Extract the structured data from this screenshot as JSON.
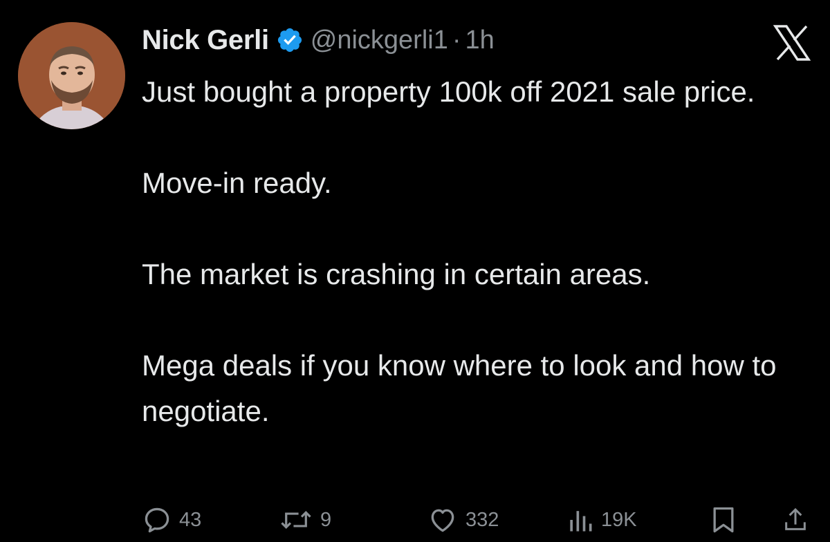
{
  "tweet": {
    "author": {
      "name": "Nick Gerli",
      "handle": "@nickgerli1",
      "separator": "·",
      "time": "1h",
      "verified": true,
      "avatar_icon": "profile-photo"
    },
    "platform_icon": "x-logo-icon",
    "body": [
      "Just bought a property 100k off 2021 sale price.",
      "Move-in ready.",
      "The market is crashing in certain areas.",
      "Mega deals if you know where to look and how to negotiate."
    ],
    "actions": {
      "replies": "43",
      "reposts": "9",
      "likes": "332",
      "views": "19K"
    }
  },
  "colors": {
    "background": "#000000",
    "text_primary": "#e7e9ea",
    "text_secondary": "#8b9095",
    "verified_blue": "#1d9bf0"
  }
}
